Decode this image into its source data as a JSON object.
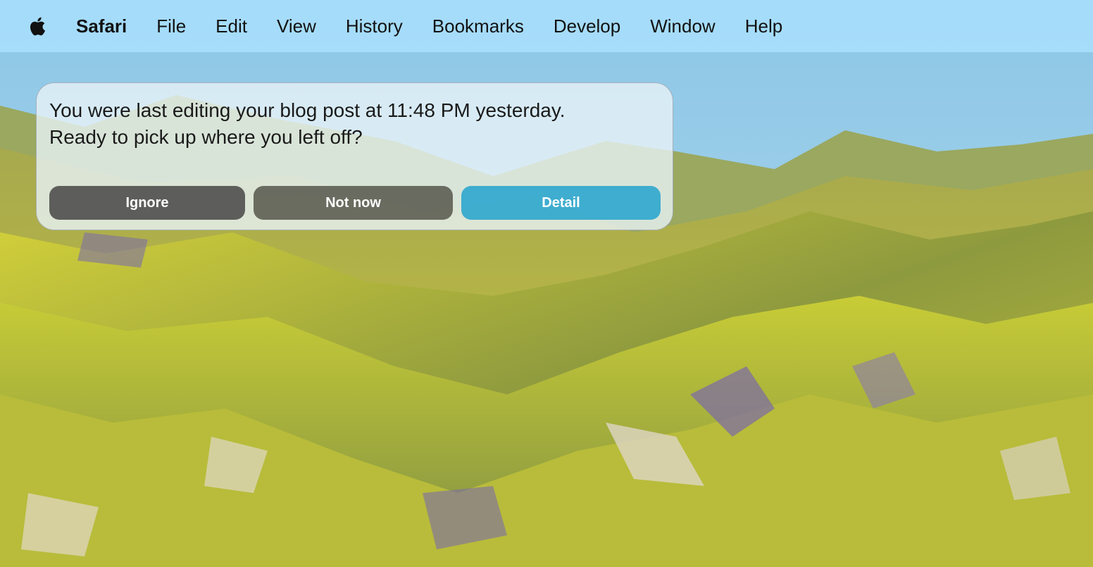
{
  "menubar": {
    "apple_icon": "apple-logo-icon",
    "app_name": "Safari",
    "items": [
      {
        "label": "File"
      },
      {
        "label": "Edit"
      },
      {
        "label": "View"
      },
      {
        "label": "History"
      },
      {
        "label": "Bookmarks"
      },
      {
        "label": "Develop"
      },
      {
        "label": "Window"
      },
      {
        "label": "Help"
      }
    ]
  },
  "notification": {
    "message_line1": "You were last editing your blog post at 11:48 PM yesterday.",
    "message_line2": "Ready to pick up where you left off?",
    "actions": {
      "ignore": "Ignore",
      "not_now": "Not now",
      "detail": "Detail"
    }
  },
  "colors": {
    "menubar_bg": "#a6ddfa",
    "detail_button": "#28a5cd",
    "dark_button": "#464646"
  }
}
